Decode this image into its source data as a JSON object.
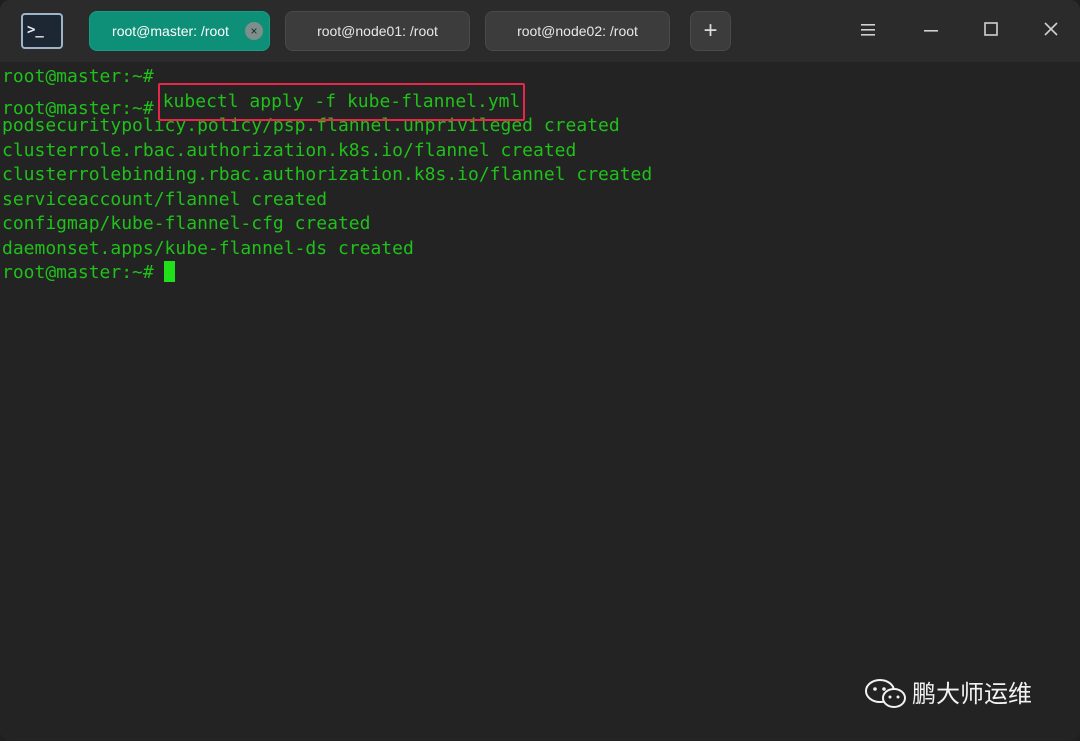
{
  "tabs": [
    {
      "label": "root@master: /root",
      "active": true,
      "close": "×"
    },
    {
      "label": "root@node01: /root",
      "active": false
    },
    {
      "label": "root@node02: /root",
      "active": false
    }
  ],
  "new_tab_label": "+",
  "app_icon": {
    "name": "terminal-icon",
    "glyph": ">_"
  },
  "window_controls": {
    "menu": "☰",
    "minimize": "–",
    "maximize": "□",
    "close": "✕"
  },
  "terminal": {
    "prompt": "root@master:~#",
    "highlighted_command": "kubectl apply -f kube-flannel.yml",
    "output": [
      "podsecuritypolicy.policy/psp.flannel.unprivileged created",
      "clusterrole.rbac.authorization.k8s.io/flannel created",
      "clusterrolebinding.rbac.authorization.k8s.io/flannel created",
      "serviceaccount/flannel created",
      "configmap/kube-flannel-cfg created",
      "daemonset.apps/kube-flannel-ds created"
    ]
  },
  "watermark": {
    "text": "鹏大师运维",
    "logo": "wechat-logo"
  },
  "colors": {
    "terminal_bg": "#232323",
    "text_green": "#1fc11a",
    "active_tab": "#0e8f78",
    "highlight_box": "#e8264a"
  }
}
